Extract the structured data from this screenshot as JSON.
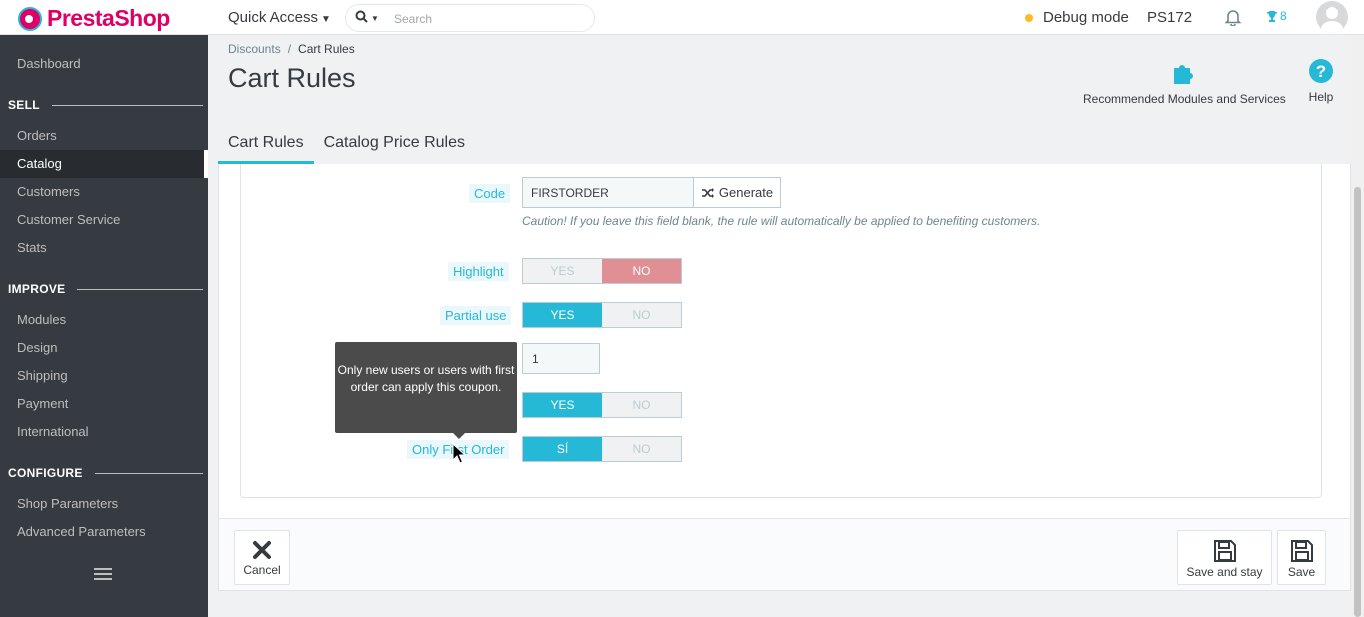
{
  "header": {
    "logo_text": "PrestaShop",
    "quick_access": "Quick Access",
    "search_placeholder": "Search",
    "debug_label": "Debug mode",
    "shop_name": "PS172",
    "trophy_count": "8"
  },
  "sidebar": {
    "dashboard": "Dashboard",
    "sections": [
      {
        "title": "SELL",
        "items": [
          "Orders",
          "Catalog",
          "Customers",
          "Customer Service",
          "Stats"
        ]
      },
      {
        "title": "IMPROVE",
        "items": [
          "Modules",
          "Design",
          "Shipping",
          "Payment",
          "International"
        ]
      },
      {
        "title": "CONFIGURE",
        "items": [
          "Shop Parameters",
          "Advanced Parameters"
        ]
      }
    ],
    "active_item": "Catalog"
  },
  "breadcrumb": {
    "parent": "Discounts",
    "separator": "/",
    "current": "Cart Rules"
  },
  "page_title": "Cart Rules",
  "toolbar": {
    "recommended": "Recommended Modules and Services",
    "help": "Help"
  },
  "tabs": [
    {
      "label": "Cart Rules",
      "active": true
    },
    {
      "label": "Catalog Price Rules",
      "active": false
    }
  ],
  "form": {
    "code_label": "Code",
    "code_value": "FIRSTORDER",
    "generate_label": "Generate",
    "code_help": "Caution! If you leave this field blank, the rule will automatically be applied to benefiting customers.",
    "highlight_label": "Highlight",
    "highlight_yes": "YES",
    "highlight_no": "NO",
    "partial_label": "Partial use",
    "partial_yes": "YES",
    "partial_no": "NO",
    "quantity_value": "1",
    "status_yes": "YES",
    "status_no": "NO",
    "first_order_label": "Only First Order",
    "first_order_yes": "SÍ",
    "first_order_no": "NO"
  },
  "tooltip": "Only new users or users with first order can apply this coupon.",
  "footer": {
    "cancel": "Cancel",
    "save_stay": "Save and stay",
    "save": "Save"
  },
  "colors": {
    "accent": "#25b9d7",
    "sidebar": "#363a41",
    "danger": "#e08f95",
    "brand": "#df0067"
  }
}
